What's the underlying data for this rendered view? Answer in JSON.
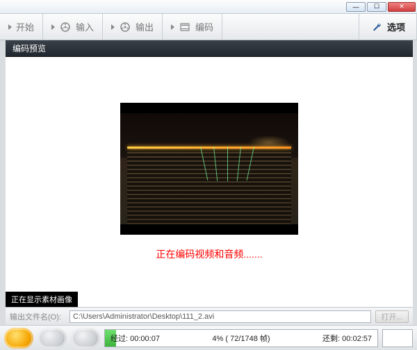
{
  "titlebar": {
    "min": "—",
    "max": "☐",
    "close": "✕"
  },
  "toolbar": {
    "start": "开始",
    "input": "输入",
    "output": "输出",
    "encode": "编码",
    "options": "选项"
  },
  "panel": {
    "title": "编码预览"
  },
  "preview": {
    "status_message": "正在编码视频和音频.......",
    "material_badge": "正在显示素材画像"
  },
  "output_row": {
    "label": "输出文件名(O):",
    "path": "C:\\Users\\Administrator\\Desktop\\111_2.avi",
    "open": "打开..."
  },
  "progress": {
    "elapsed_label": "经过:",
    "elapsed_value": "00:00:07",
    "percent_text": "4% ( 72/1748 帧)",
    "remain_label": "还剩:",
    "remain_value": "00:02:57"
  }
}
